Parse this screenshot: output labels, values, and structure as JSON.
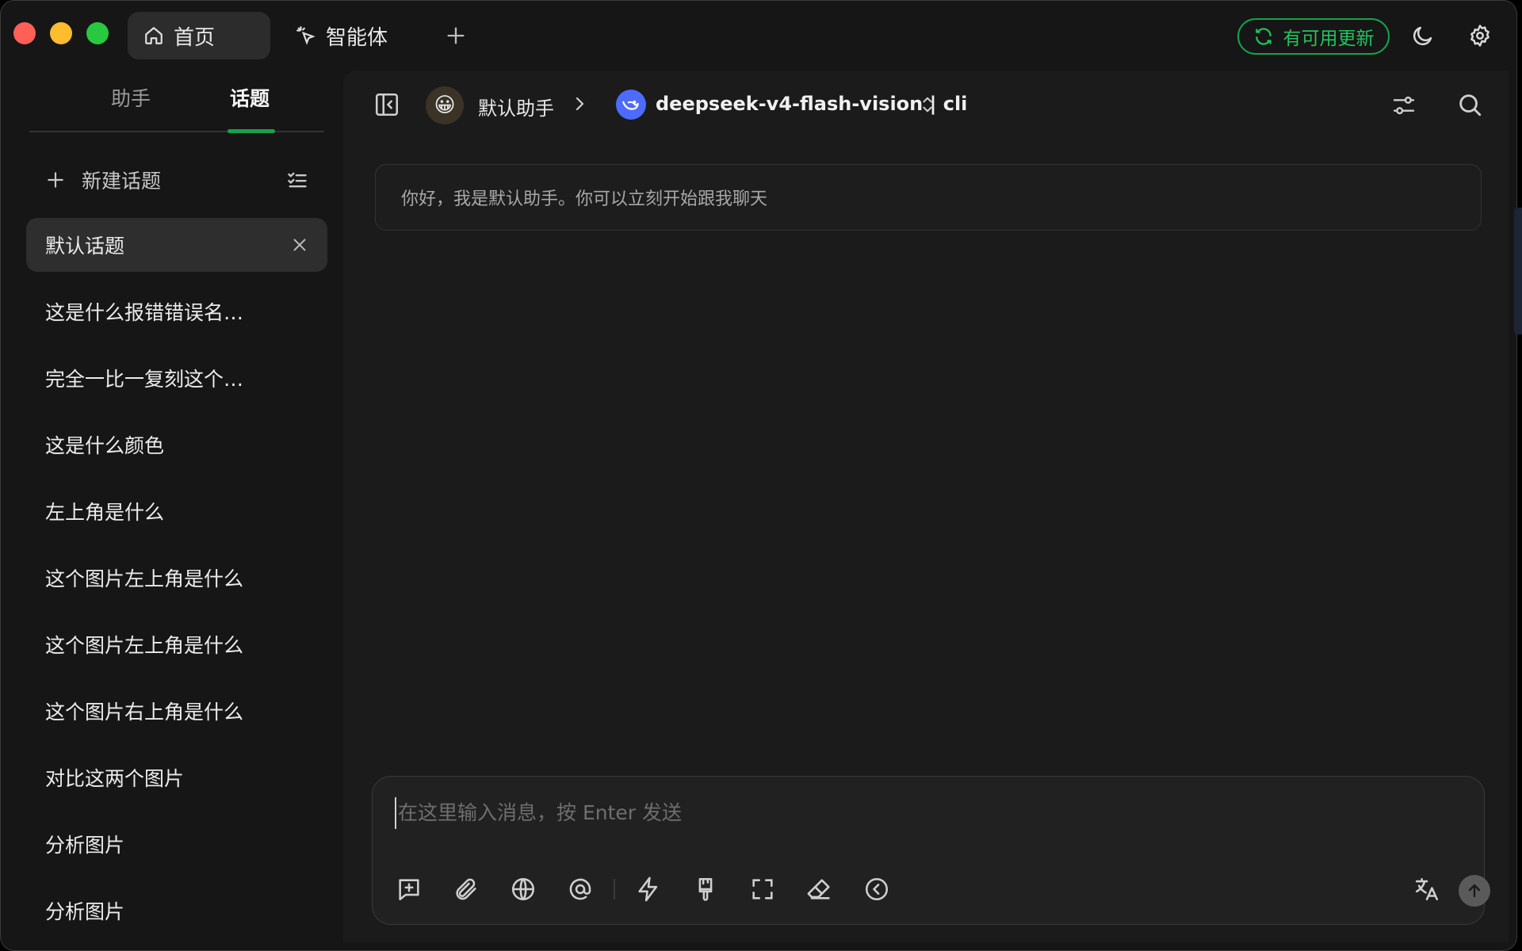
{
  "titlebar": {
    "tabs": [
      {
        "label": "首页",
        "icon": "home-icon"
      },
      {
        "label": "智能体",
        "icon": "sparkle-cursor-icon"
      }
    ],
    "add_tab_icon": "plus-icon",
    "update_label": "有可用更新",
    "theme_icon": "moon-icon",
    "settings_icon": "gear-icon"
  },
  "sidebar": {
    "tabs": [
      {
        "label": "助手"
      },
      {
        "label": "话题",
        "active": true
      }
    ],
    "new_topic_label": "新建话题",
    "topics": [
      {
        "label": "默认话题",
        "active": true
      },
      {
        "label": "这是什么报错错误名…"
      },
      {
        "label": "完全一比一复刻这个…"
      },
      {
        "label": "这是什么颜色"
      },
      {
        "label": "左上角是什么"
      },
      {
        "label": "这个图片左上角是什么"
      },
      {
        "label": "这个图片左上角是什么"
      },
      {
        "label": "这个图片右上角是什么"
      },
      {
        "label": "对比这两个图片"
      },
      {
        "label": "分析图片"
      },
      {
        "label": "分析图片"
      }
    ]
  },
  "header": {
    "assistant_avatar": "😀",
    "assistant_name": "默认助手",
    "model_name": "deepseek-v4-flash-vision | cli"
  },
  "chat": {
    "greeting": "你好，我是默认助手。你可以立刻开始跟我聊天"
  },
  "composer": {
    "placeholder": "在这里输入消息，按 Enter 发送",
    "tools": [
      "new-topic-icon",
      "attachment-icon",
      "web-search-icon",
      "mention-icon",
      "quick-phrase-icon",
      "clear-context-icon",
      "fullscreen-icon",
      "eraser-icon",
      "collapse-icon"
    ]
  },
  "colors": {
    "accent_green": "#16a34a",
    "background": "#161616",
    "panel": "#1b1b1b"
  }
}
